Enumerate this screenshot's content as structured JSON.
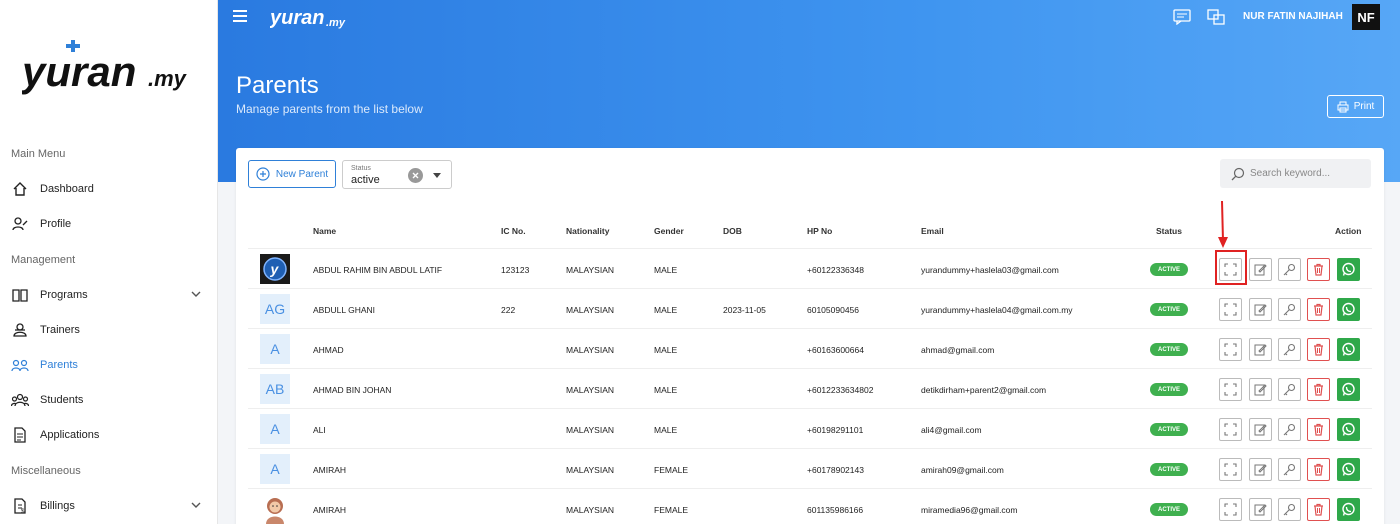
{
  "sidebar": {
    "logo_text": "yuran.my",
    "sections": {
      "main": "Main Menu",
      "management": "Management",
      "misc": "Miscellaneous"
    },
    "items": [
      {
        "label": "Dashboard",
        "icon": "home-icon"
      },
      {
        "label": "Profile",
        "icon": "profile-icon"
      },
      {
        "label": "Programs",
        "icon": "book-icon"
      },
      {
        "label": "Trainers",
        "icon": "trainer-icon"
      },
      {
        "label": "Parents",
        "icon": "parents-icon"
      },
      {
        "label": "Students",
        "icon": "students-icon"
      },
      {
        "label": "Applications",
        "icon": "document-icon"
      },
      {
        "label": "Billings",
        "icon": "billing-icon"
      }
    ],
    "active_item": "Parents"
  },
  "header": {
    "logo_text": "yuran.my",
    "user_name": "NUR FATIN NAJIHAH",
    "user_initials": "NF"
  },
  "page": {
    "title": "Parents",
    "subtitle": "Manage parents from the list below",
    "print_label": "Print"
  },
  "toolbar": {
    "new_parent_label": "New Parent",
    "status_label": "Status",
    "status_value": "active",
    "search_placeholder": "Search keyword..."
  },
  "table": {
    "headers": {
      "name": "Name",
      "ic": "IC No.",
      "nationality": "Nationality",
      "gender": "Gender",
      "dob": "DOB",
      "hp": "HP No",
      "email": "Email",
      "status": "Status",
      "action": "Action"
    },
    "rows": [
      {
        "avatar": "",
        "avatar_type": "logo",
        "name": "ABDUL RAHIM BIN ABDUL LATIF",
        "ic": "123123",
        "nationality": "MALAYSIAN",
        "gender": "MALE",
        "dob": "",
        "hp": "+60122336348",
        "email": "yurandummy+haslela03@gmail.com",
        "status": "ACTIVE"
      },
      {
        "avatar": "AG",
        "avatar_type": "initials",
        "name": "ABDULL GHANI",
        "ic": "222",
        "nationality": "MALAYSIAN",
        "gender": "MALE",
        "dob": "2023-11-05",
        "hp": "60105090456",
        "email": "yurandummy+haslela04@gmail.com.my",
        "status": "ACTIVE"
      },
      {
        "avatar": "A",
        "avatar_type": "initials",
        "name": "AHMAD",
        "ic": "",
        "nationality": "MALAYSIAN",
        "gender": "MALE",
        "dob": "",
        "hp": "+60163600664",
        "email": "ahmad@gmail.com",
        "status": "ACTIVE"
      },
      {
        "avatar": "AB",
        "avatar_type": "initials",
        "name": "AHMAD BIN JOHAN",
        "ic": "",
        "nationality": "MALAYSIAN",
        "gender": "MALE",
        "dob": "",
        "hp": "+6012233634802",
        "email": "detikdirham+parent2@gmail.com",
        "status": "ACTIVE"
      },
      {
        "avatar": "A",
        "avatar_type": "initials",
        "name": "ALI",
        "ic": "",
        "nationality": "MALAYSIAN",
        "gender": "MALE",
        "dob": "",
        "hp": "+60198291101",
        "email": "ali4@gmail.com",
        "status": "ACTIVE"
      },
      {
        "avatar": "A",
        "avatar_type": "initials",
        "name": "AMIRAH",
        "ic": "",
        "nationality": "MALAYSIAN",
        "gender": "FEMALE",
        "dob": "",
        "hp": "+60178902143",
        "email": "amirah09@gmail.com",
        "status": "ACTIVE"
      },
      {
        "avatar": "",
        "avatar_type": "photo",
        "name": "AMIRAH",
        "ic": "",
        "nationality": "MALAYSIAN",
        "gender": "FEMALE",
        "dob": "",
        "hp": "601135986166",
        "email": "miramedia96@gmail.com",
        "status": "ACTIVE"
      }
    ],
    "actions": [
      "expand-icon",
      "edit-icon",
      "key-icon",
      "trash-icon",
      "whatsapp-icon"
    ]
  },
  "colors": {
    "primary": "#2f80d8",
    "active_badge": "#3fb04f",
    "delete": "#e05050",
    "whatsapp": "#2fa84a",
    "highlight": "#e02222"
  }
}
